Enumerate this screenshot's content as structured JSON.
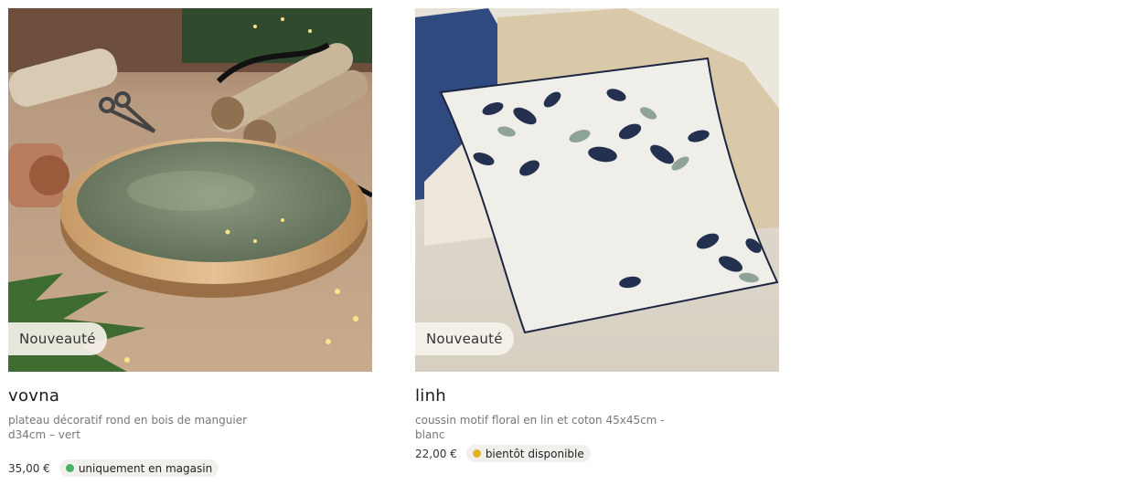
{
  "products": [
    {
      "badge": "Nouveauté",
      "name": "vovna",
      "description": "plateau décoratif rond en bois de manguier d34cm – vert",
      "price": "35,00 €",
      "availability": "uniquement en magasin",
      "availability_color": "#4caf68",
      "image_icon": "decorative-tray-photo"
    },
    {
      "badge": "Nouveauté",
      "name": "linh",
      "description": "coussin motif floral en lin et coton 45x45cm - blanc",
      "price": "22,00 €",
      "availability": "bientôt disponible",
      "availability_color": "#e0b323",
      "image_icon": "floral-cushion-photo"
    }
  ]
}
